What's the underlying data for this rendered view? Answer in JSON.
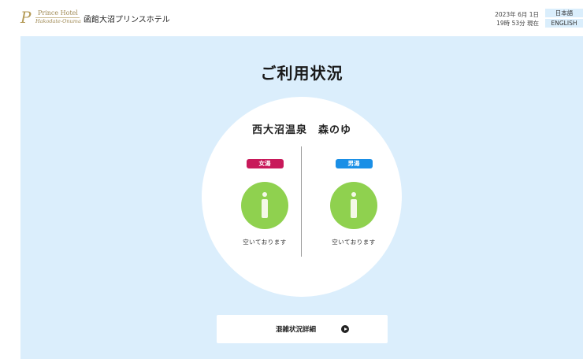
{
  "header": {
    "logo": {
      "mark": "P",
      "line1": "Prince Hotel",
      "line2": "Hakodate-Onuma"
    },
    "hotel_name": "函館大沼プリンスホテル",
    "date": "2023年 6月 1日",
    "time": "19時 53分 現在",
    "lang": {
      "ja": "日本語",
      "en": "ENGLISH"
    }
  },
  "main": {
    "title": "ご利用状況",
    "facility_name": "西大沼温泉　森のゆ",
    "baths": [
      {
        "label": "女湯",
        "status": "空いております",
        "color": "#c8195a"
      },
      {
        "label": "男湯",
        "status": "空いております",
        "color": "#1a8fe6"
      }
    ],
    "status_color": "#8fd14f",
    "detail_button": "混雑状況詳細"
  }
}
